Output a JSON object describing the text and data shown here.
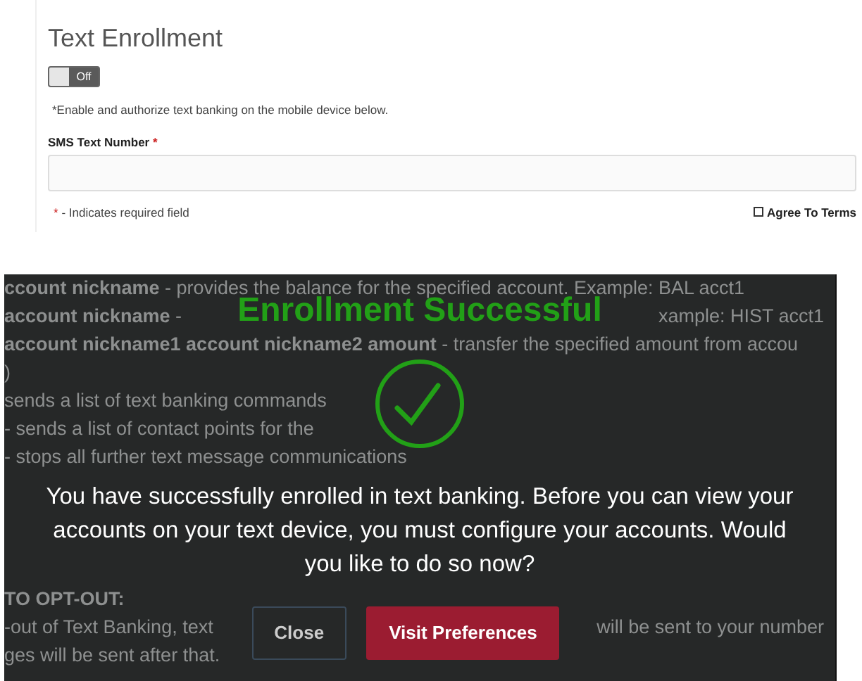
{
  "enrollment": {
    "title": "Text Enrollment",
    "toggle": {
      "on": false,
      "label": "Off"
    },
    "note": "*Enable and authorize text banking on the mobile device below.",
    "field": {
      "label": "SMS Text Number",
      "required_mark": "*"
    },
    "required_note": {
      "mark": "*",
      "text": "- Indicates required field"
    },
    "agree": {
      "label": "Agree To Terms",
      "checked": false
    }
  },
  "background": {
    "commands": [
      {
        "text": "**ccount nickname** - provides the balance for the specified account. Example: BAL acct1"
      },
      {
        "text": "**account nickname** -",
        "tail": "xample: HIST acct1"
      },
      {
        "text": "**account nickname1 account nickname2 amount** - transfer the specified amount from accou"
      },
      {
        "text": ")"
      },
      {
        "text": "sends a list of text banking commands"
      },
      {
        "text": "- sends a list of contact points for the"
      },
      {
        "text": "- stops all further text message communications"
      }
    ],
    "opt_out": {
      "heading": "TO OPT-OUT:",
      "lines": [
        {
          "text": "-out of Text Banking, text",
          "tail": "will be sent to your number"
        },
        {
          "text": "ges will be sent after that."
        }
      ]
    }
  },
  "dialog": {
    "title": "Enrollment Successful",
    "message": "You have successfully enrolled in text banking. Before you can view your accounts on your text device, you must configure your accounts. Would you like to do so now?",
    "buttons": [
      {
        "label": "Close",
        "kind": "secondary"
      },
      {
        "label": "Visit Preferences",
        "kind": "primary"
      }
    ]
  }
}
